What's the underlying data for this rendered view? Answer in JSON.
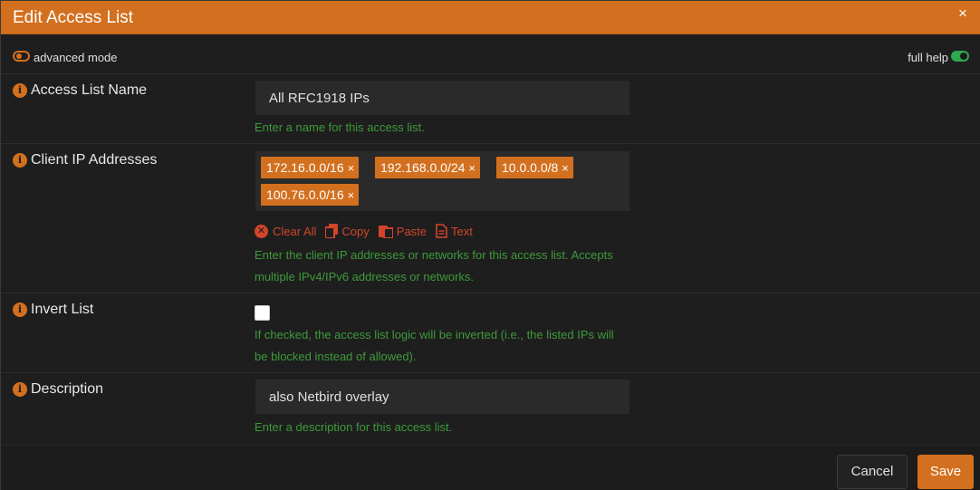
{
  "dialog": {
    "title": "Edit Access List",
    "close_symbol": "×"
  },
  "toolbar": {
    "advanced_mode_label": "advanced mode",
    "full_help_label": "full help",
    "full_help_enabled": true,
    "advanced_mode_enabled": false
  },
  "fields": {
    "name": {
      "label": "Access List Name",
      "value": "All RFC1918 IPs",
      "help": "Enter a name for this access list."
    },
    "clients": {
      "label": "Client IP Addresses",
      "tags": [
        {
          "text": "172.16.0.0/16"
        },
        {
          "text": "192.168.0.0/24"
        },
        {
          "text": "10.0.0.0/8"
        },
        {
          "text": "100.76.0.0/16"
        }
      ],
      "tag_remove_symbol": "×",
      "actions": {
        "clear": "Clear All",
        "copy": "Copy",
        "paste": "Paste",
        "text": "Text"
      },
      "help_line1": "Enter the client IP addresses or networks for this access list. Accepts",
      "help_line2": "multiple IPv4/IPv6 addresses or networks."
    },
    "invert": {
      "label": "Invert List",
      "checked": false,
      "help_line1": "If checked, the access list logic will be inverted (i.e., the listed IPs will",
      "help_line2": "be blocked instead of allowed)."
    },
    "description": {
      "label": "Description",
      "value": "also Netbird overlay",
      "help": "Enter a description for this access list."
    }
  },
  "footer": {
    "cancel_label": "Cancel",
    "save_label": "Save"
  },
  "colors": {
    "accent": "#d3701f",
    "help_text": "#3e9a3a",
    "action_red": "#d3452b",
    "toggle_on": "#2fa84f"
  }
}
